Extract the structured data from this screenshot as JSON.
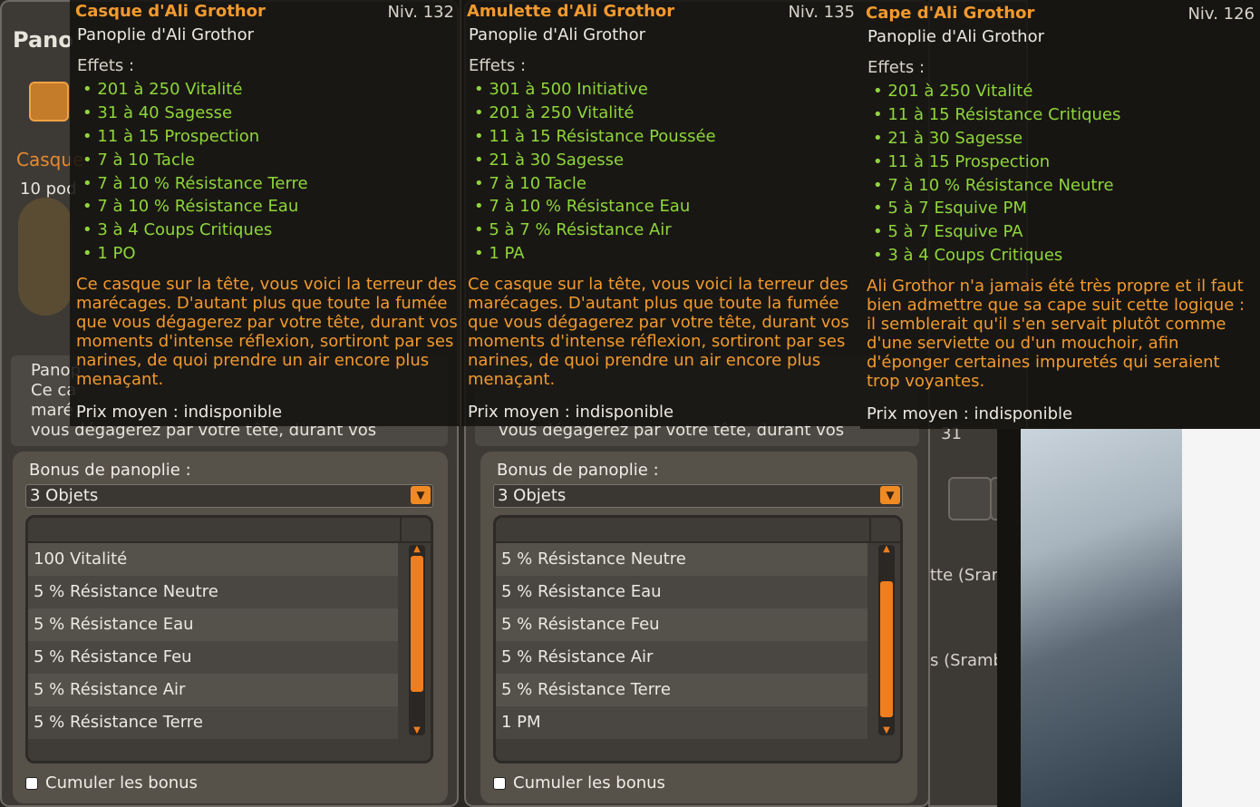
{
  "window1": {
    "title": "Pano",
    "item_label": "Casque",
    "pods": "10 pod",
    "desc_bg_lines": [
      "Panop",
      "Ce ca",
      "maré",
      "vous dégagerez par votre tête, durant vos"
    ],
    "bonus_title": "Bonus de panoplie :",
    "dropdown_value": "3 Objets",
    "bonus_rows": [
      "100 Vitalité",
      "5 % Résistance Neutre",
      "5 % Résistance Eau",
      "5 % Résistance Feu",
      "5 % Résistance Air",
      "5 % Résistance Terre"
    ],
    "cumul_label": "Cumuler les bonus"
  },
  "window2": {
    "desc_bg_line": "vous dégagerez par votre tête, durant vos",
    "bonus_title": "Bonus de panoplie :",
    "dropdown_value": "3 Objets",
    "bonus_rows": [
      "5 % Résistance Neutre",
      "5 % Résistance Eau",
      "5 % Résistance Feu",
      "5 % Résistance Air",
      "5 % Résistance Terre",
      "1 PM"
    ],
    "cumul_label": "Cumuler les bonus"
  },
  "window3": {
    "list_snippets": [
      "tte (Sran",
      "s (Sramb"
    ],
    "number": "31"
  },
  "tooltips": [
    {
      "name": "Casque d'Ali Grothor",
      "level": "Niv. 132",
      "set": "Panoplie d'Ali Grothor",
      "effets_label": "Effets :",
      "effects": [
        "201 à 250 Vitalité",
        "31 à 40 Sagesse",
        "11 à 15 Prospection",
        "7 à 10 Tacle",
        "7 à 10 % Résistance Terre",
        "7 à 10 % Résistance Eau",
        "3 à 4 Coups Critiques",
        "1 PO"
      ],
      "description": "Ce casque sur la tête, vous voici la terreur des marécages. D'autant plus que toute la fumée que vous dégagerez par votre tête, durant vos moments d'intense réflexion, sortiront par ses narines, de quoi prendre un air encore plus menaçant.",
      "price": "Prix moyen : indisponible"
    },
    {
      "name": "Amulette d'Ali Grothor",
      "level": "Niv. 135",
      "set": "Panoplie d'Ali Grothor",
      "effets_label": "Effets :",
      "effects": [
        "301 à 500 Initiative",
        "201 à 250 Vitalité",
        "11 à 15 Résistance Poussée",
        "21 à 30 Sagesse",
        "7 à 10 Tacle",
        "7 à 10 % Résistance Eau",
        "5 à 7 % Résistance Air",
        "1 PA"
      ],
      "description": "Ce casque sur la tête, vous voici la terreur des marécages. D'autant plus que toute la fumée que vous dégagerez par votre tête, durant vos moments d'intense réflexion, sortiront par ses narines, de quoi prendre un air encore plus menaçant.",
      "price": "Prix moyen : indisponible"
    },
    {
      "name": "Cape d'Ali Grothor",
      "level": "Niv. 126",
      "set": "Panoplie d'Ali Grothor",
      "effets_label": "Effets :",
      "effects": [
        "201 à 250 Vitalité",
        "11 à 15 Résistance Critiques",
        "21 à 30 Sagesse",
        "11 à 15 Prospection",
        "7 à 10 % Résistance Neutre",
        "5 à 7 Esquive PM",
        "5 à 7 Esquive PA",
        "3 à 4 Coups Critiques"
      ],
      "description": "Ali Grothor n'a jamais été très propre et il faut bien admettre que sa cape suit cette logique : il semblerait qu'il s'en servait plutôt comme d'une serviette ou d'un mouchoir, afin d'éponger certaines impuretés qui seraient trop voyantes.",
      "price": "Prix moyen : indisponible"
    }
  ]
}
